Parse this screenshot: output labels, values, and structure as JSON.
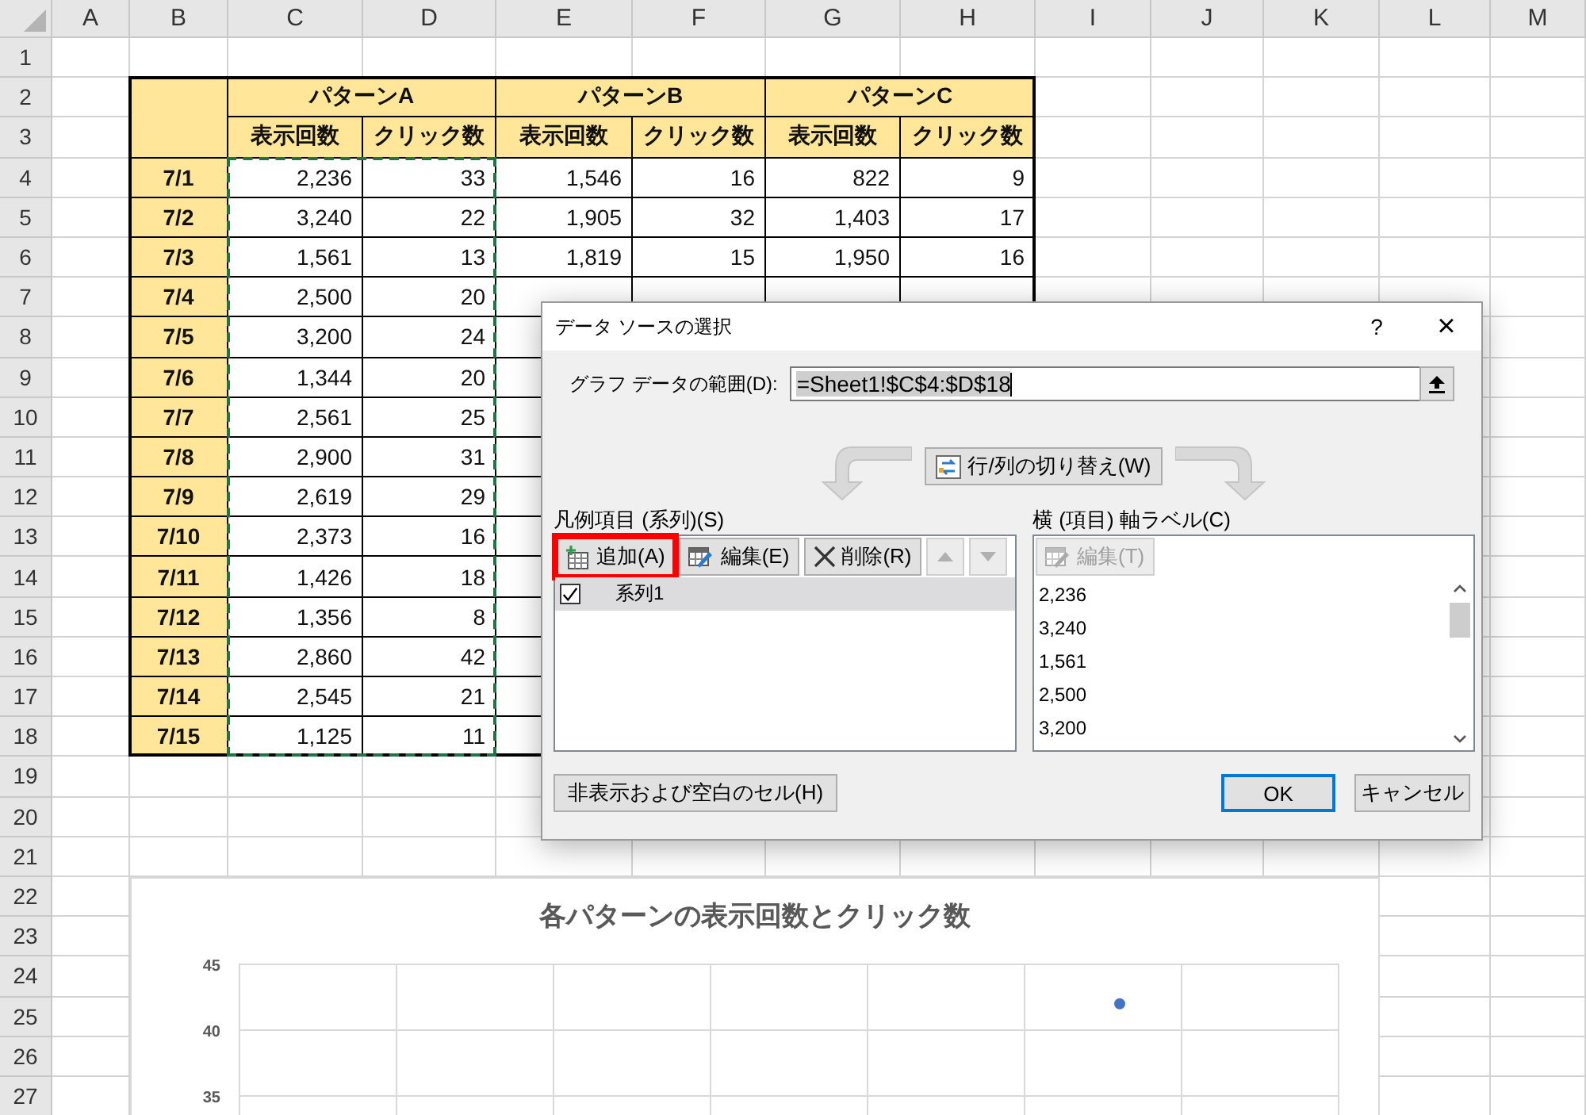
{
  "sheet": {
    "columns": [
      "A",
      "B",
      "C",
      "D",
      "E",
      "F",
      "G",
      "H",
      "I",
      "J",
      "K",
      "L",
      "M"
    ],
    "rows": [
      "1",
      "2",
      "3",
      "4",
      "5",
      "6",
      "7",
      "8",
      "9",
      "10",
      "11",
      "12",
      "13",
      "14",
      "15",
      "16",
      "17",
      "18",
      "19",
      "20",
      "21",
      "22",
      "23",
      "24",
      "25",
      "26",
      "27"
    ]
  },
  "table": {
    "groups": [
      {
        "label": "パターンA",
        "columns": [
          "表示回数",
          "クリック数"
        ]
      },
      {
        "label": "パターンB",
        "columns": [
          "表示回数",
          "クリック数"
        ]
      },
      {
        "label": "パターンC",
        "columns": [
          "表示回数",
          "クリック数"
        ]
      }
    ],
    "rows": [
      {
        "date": "7/1",
        "values": [
          "2,236",
          "33",
          "1,546",
          "16",
          "822",
          "9"
        ]
      },
      {
        "date": "7/2",
        "values": [
          "3,240",
          "22",
          "1,905",
          "32",
          "1,403",
          "17"
        ]
      },
      {
        "date": "7/3",
        "values": [
          "1,561",
          "13",
          "1,819",
          "15",
          "1,950",
          "16"
        ]
      },
      {
        "date": "7/4",
        "values": [
          "2,500",
          "20"
        ]
      },
      {
        "date": "7/5",
        "values": [
          "3,200",
          "24"
        ]
      },
      {
        "date": "7/6",
        "values": [
          "1,344",
          "20"
        ]
      },
      {
        "date": "7/7",
        "values": [
          "2,561",
          "25"
        ]
      },
      {
        "date": "7/8",
        "values": [
          "2,900",
          "31"
        ]
      },
      {
        "date": "7/9",
        "values": [
          "2,619",
          "29"
        ]
      },
      {
        "date": "7/10",
        "values": [
          "2,373",
          "16"
        ]
      },
      {
        "date": "7/11",
        "values": [
          "1,426",
          "18"
        ]
      },
      {
        "date": "7/12",
        "values": [
          "1,356",
          "8"
        ]
      },
      {
        "date": "7/13",
        "values": [
          "2,860",
          "42"
        ]
      },
      {
        "date": "7/14",
        "values": [
          "2,545",
          "21"
        ]
      },
      {
        "date": "7/15",
        "values": [
          "1,125",
          "11"
        ]
      }
    ]
  },
  "chart": {
    "chart_data": {
      "type": "scatter",
      "title": "各パターンの表示回数とクリック数",
      "ylim": [
        30,
        45
      ],
      "yticks": [
        35,
        40,
        45
      ],
      "series": [
        {
          "color": "#4472c4",
          "values": [
            42
          ]
        }
      ]
    }
  },
  "dialog": {
    "title": "データ ソースの選択",
    "help": "?",
    "close": "×",
    "range": {
      "label": "グラフ データの範囲(D):",
      "value": "=Sheet1!$C$4:$D$18"
    },
    "switch_button": "行/列の切り替え(W)",
    "legend": {
      "label": "凡例項目 (系列)(S)",
      "buttons": [
        {
          "kind": "add",
          "label": "追加(A)",
          "highlighted": true,
          "disabled": false
        },
        {
          "kind": "edit",
          "label": "編集(E)",
          "highlighted": false,
          "disabled": false
        },
        {
          "kind": "delete",
          "label": "削除(R)",
          "highlighted": false,
          "disabled": false
        },
        {
          "kind": "up",
          "highlighted": false,
          "disabled": true
        },
        {
          "kind": "down",
          "highlighted": false,
          "disabled": true
        }
      ],
      "items": [
        {
          "label": "系列1",
          "checked": true,
          "selected": true
        }
      ]
    },
    "axis": {
      "label": "横 (項目) 軸ラベル(C)",
      "edit_button": {
        "label": "編集(T)",
        "disabled": true
      },
      "items": [
        "2,236",
        "3,240",
        "1,561",
        "2,500",
        "3,200"
      ]
    },
    "hidden_cells_button": "非表示および空白のセル(H)",
    "ok_button": "OK",
    "cancel_button": "キャンセル"
  }
}
